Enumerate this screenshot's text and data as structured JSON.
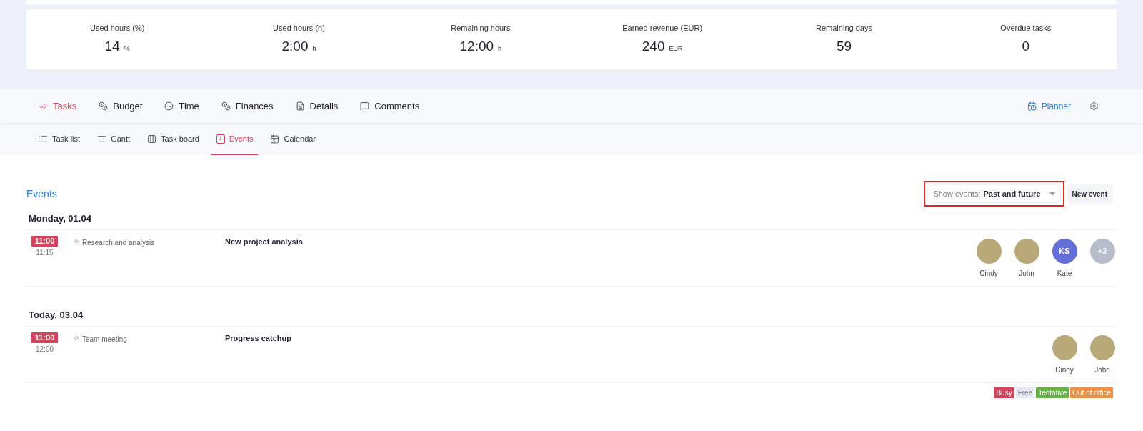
{
  "stats": [
    {
      "label": "Used hours (%)",
      "value": "14",
      "unit": "%"
    },
    {
      "label": "Used hours (h)",
      "value": "2:00",
      "unit": "h"
    },
    {
      "label": "Remaining hours",
      "value": "12:00",
      "unit": "h"
    },
    {
      "label": "Earned revenue (EUR)",
      "value": "240",
      "unit": "EUR"
    },
    {
      "label": "Remaining days",
      "value": "59"
    },
    {
      "label": "Overdue tasks",
      "value": "0"
    }
  ],
  "tabs": [
    {
      "label": "Tasks",
      "selected": true
    },
    {
      "label": "Budget",
      "selected": false
    },
    {
      "label": "Time",
      "selected": false
    },
    {
      "label": "Finances",
      "selected": false
    },
    {
      "label": "Details",
      "selected": false
    },
    {
      "label": "Comments",
      "selected": false
    }
  ],
  "planner": {
    "label": "Planner"
  },
  "subtabs": [
    {
      "label": "Task list",
      "selected": false
    },
    {
      "label": "Gantt",
      "selected": false
    },
    {
      "label": "Task board",
      "selected": false
    },
    {
      "label": "Events",
      "selected": true,
      "badge": "1"
    },
    {
      "label": "Calendar",
      "selected": false
    }
  ],
  "events_title": "Events",
  "filter": {
    "label": "Show events:",
    "value": "Past and future",
    "highlighted": true
  },
  "new_event": "New event",
  "days": [
    {
      "heading": "Monday, 01.04",
      "events": [
        {
          "start": "11:00",
          "end": "11:15",
          "type": "Research and analysis",
          "title": "New project analysis",
          "attendees": [
            {
              "kind": "photo",
              "name": "Cindy"
            },
            {
              "kind": "photo",
              "name": "John"
            },
            {
              "kind": "initials",
              "initials": "KS",
              "name": "Kate",
              "color": "#6470d8"
            },
            {
              "kind": "more",
              "initials": "+2"
            }
          ]
        }
      ]
    },
    {
      "heading": "Today, 03.04",
      "events": [
        {
          "start": "11:00",
          "end": "12:00",
          "type": "Team meeting",
          "title": "Progress catchup",
          "attendees": [
            {
              "kind": "photo",
              "name": "Cindy"
            },
            {
              "kind": "photo",
              "name": "John"
            }
          ]
        }
      ]
    }
  ],
  "legend": [
    {
      "label": "Busy",
      "color": "#d4455c"
    },
    {
      "label": "Free",
      "color": "#e3e8f3"
    },
    {
      "label": "Tentative",
      "color": "#67b045"
    },
    {
      "label": "Out of office",
      "color": "#ea9147"
    }
  ]
}
